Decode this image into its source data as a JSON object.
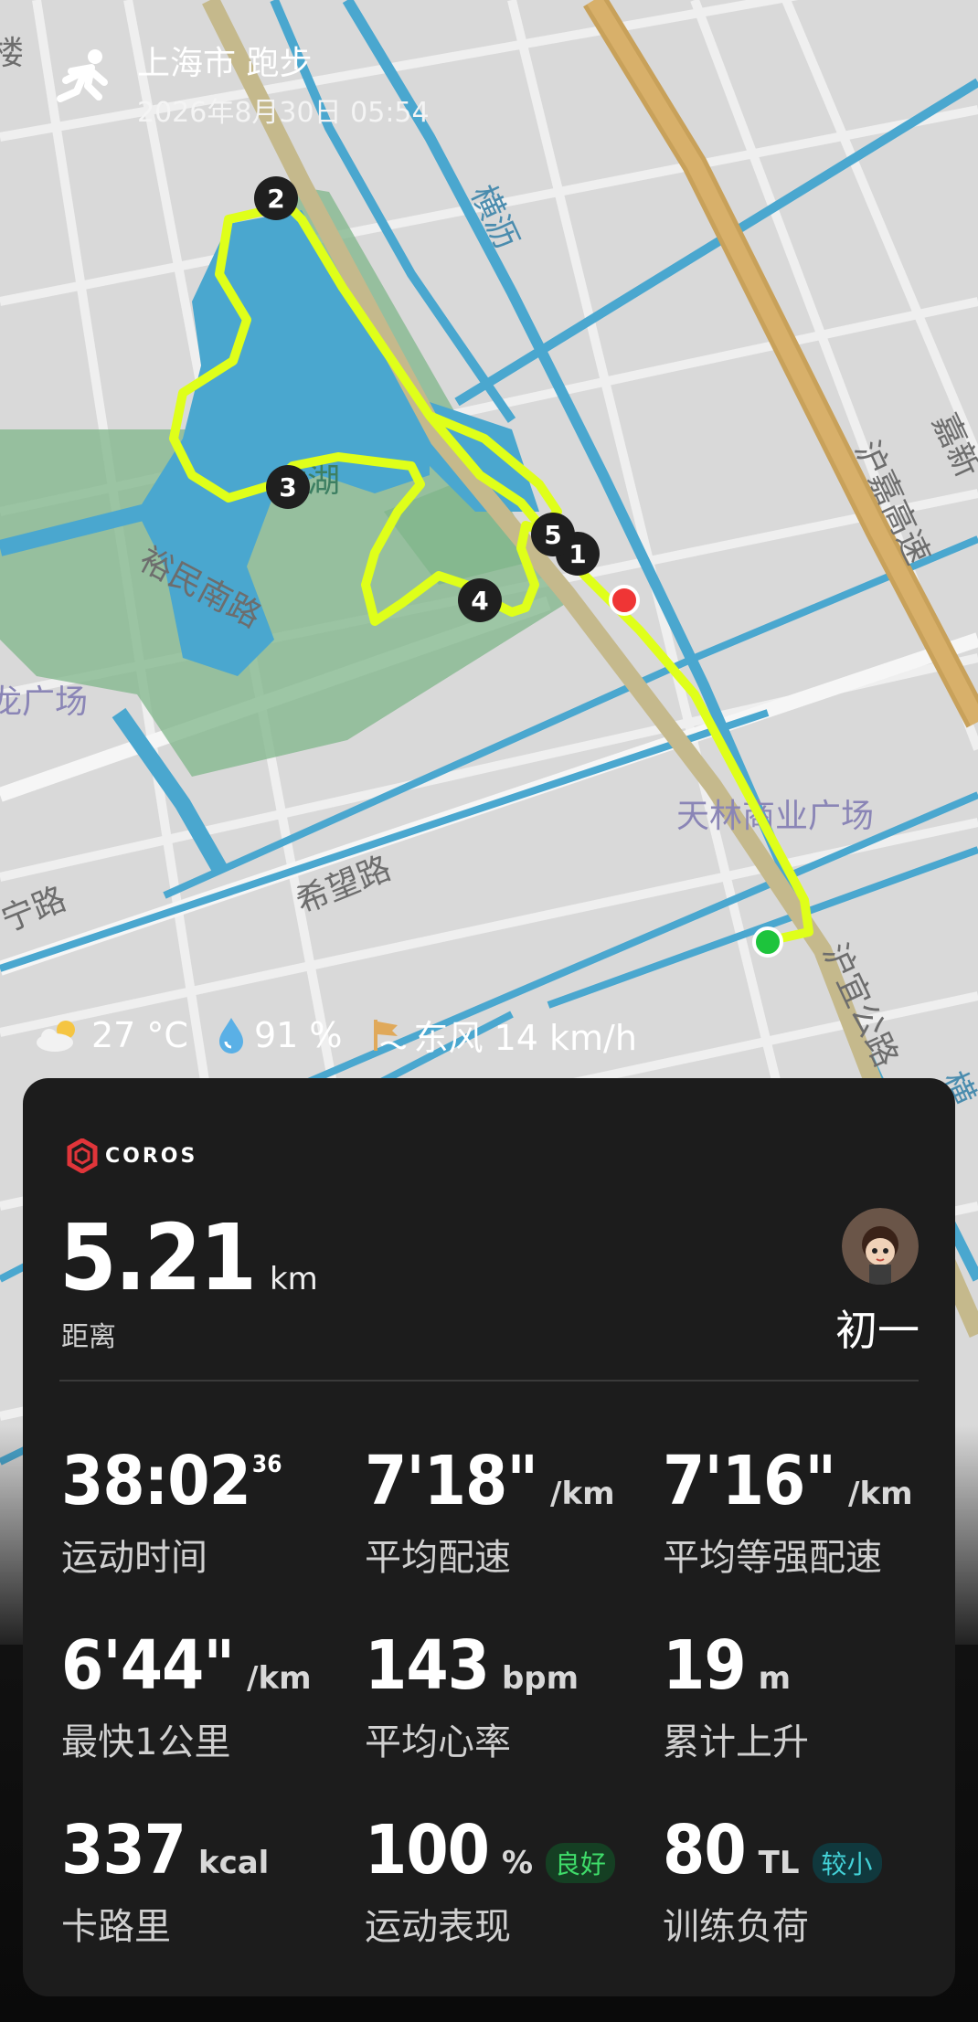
{
  "header": {
    "title": "上海市 跑步",
    "datetime": "2026年8月30日 05:54"
  },
  "map": {
    "places": {
      "lake": "香湖",
      "road_yumin": "裕民南路",
      "road_xiwang": "希望路",
      "road_ning": "宁路",
      "plaza_left": "龙广场",
      "plaza_tianlin": "天林商业广场",
      "road_huyi": "沪宜公路",
      "highway": "沪嘉高速",
      "river_hengli": "横沥",
      "jia_xin": "嘉新",
      "lou": "楼",
      "heng_right": "横"
    },
    "markers": [
      "1",
      "2",
      "3",
      "4",
      "5"
    ],
    "colors": {
      "route": "#dfff1a",
      "start": "#1dc43c",
      "end": "#ef3535",
      "water": "#4aa7cf",
      "park": "#7fb58a"
    }
  },
  "weather": {
    "temp": "27 °C",
    "humidity": "91 %",
    "wind": "东风 14 km/h"
  },
  "card": {
    "brand": "COROS",
    "distance": {
      "value": "5.21",
      "unit": "km",
      "label": "距离"
    },
    "user": "初一",
    "stats": [
      {
        "value": "38:02",
        "sup": "36",
        "unit": "",
        "label": "运动时间"
      },
      {
        "value": "7'18\"",
        "unit": "/km",
        "label": "平均配速"
      },
      {
        "value": "7'16\"",
        "unit": "/km",
        "label": "平均等强配速"
      },
      {
        "value": "6'44\"",
        "unit": "/km",
        "label": "最快1公里"
      },
      {
        "value": "143",
        "unit": "bpm",
        "label": "平均心率"
      },
      {
        "value": "19",
        "unit": "m",
        "label": "累计上升"
      },
      {
        "value": "337",
        "unit": "kcal",
        "label": "卡路里"
      },
      {
        "value": "100",
        "unit": "%",
        "badge": "良好",
        "label": "运动表现"
      },
      {
        "value": "80",
        "unit": "TL",
        "badge": "较小",
        "label": "训练负荷"
      }
    ]
  }
}
